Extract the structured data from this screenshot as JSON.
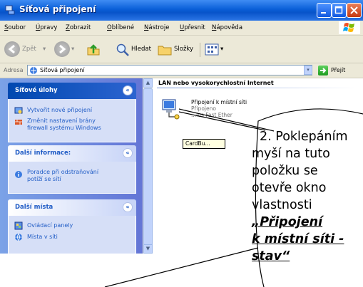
{
  "window": {
    "title": "Síťová připojení"
  },
  "menu": [
    "Soubor",
    "Úpravy",
    "Zobrazit",
    "Oblíbené",
    "Nástroje",
    "Upřesnit",
    "Nápověda"
  ],
  "toolbar": {
    "back_label": "Zpět",
    "search_label": "Hledat",
    "folders_label": "Složky"
  },
  "address": {
    "label": "Adresa",
    "value": "Síťová připojení",
    "go_label": "Přejít"
  },
  "sidebar": {
    "network_tasks": {
      "title": "Síťové úlohy",
      "items": [
        "Vytvořit nové připojení",
        "Změnit nastavení brány",
        "firewall systému Windows"
      ]
    },
    "more_info": {
      "title": "Další informace:",
      "items": [
        "Poradce při odstraňování",
        "potíží se sítí"
      ]
    },
    "other_places": {
      "title": "Další místa",
      "items": [
        "Ovládací panely",
        "Místa v síti"
      ]
    }
  },
  "content": {
    "group_title": "LAN nebo vysokorychlostní Internet",
    "connection": {
      "name": "Připojení k místní síti",
      "status": "Připojeno",
      "device": "...lus Fast Ether"
    },
    "tooltip": "CardBu..."
  },
  "callout": {
    "lines": [
      "2. Poklepáním",
      "myší na tuto",
      "položku se",
      "otevře okno",
      "vlastnosti"
    ],
    "bold_lines": [
      "„Připojení",
      "k místní síti -",
      "stav“"
    ]
  },
  "colors": {
    "title_bar": "#0a5fd8",
    "sidebar_bg": "#7ba2e7",
    "link": "#215dc6",
    "tooltip_bg": "#ffffe1"
  }
}
